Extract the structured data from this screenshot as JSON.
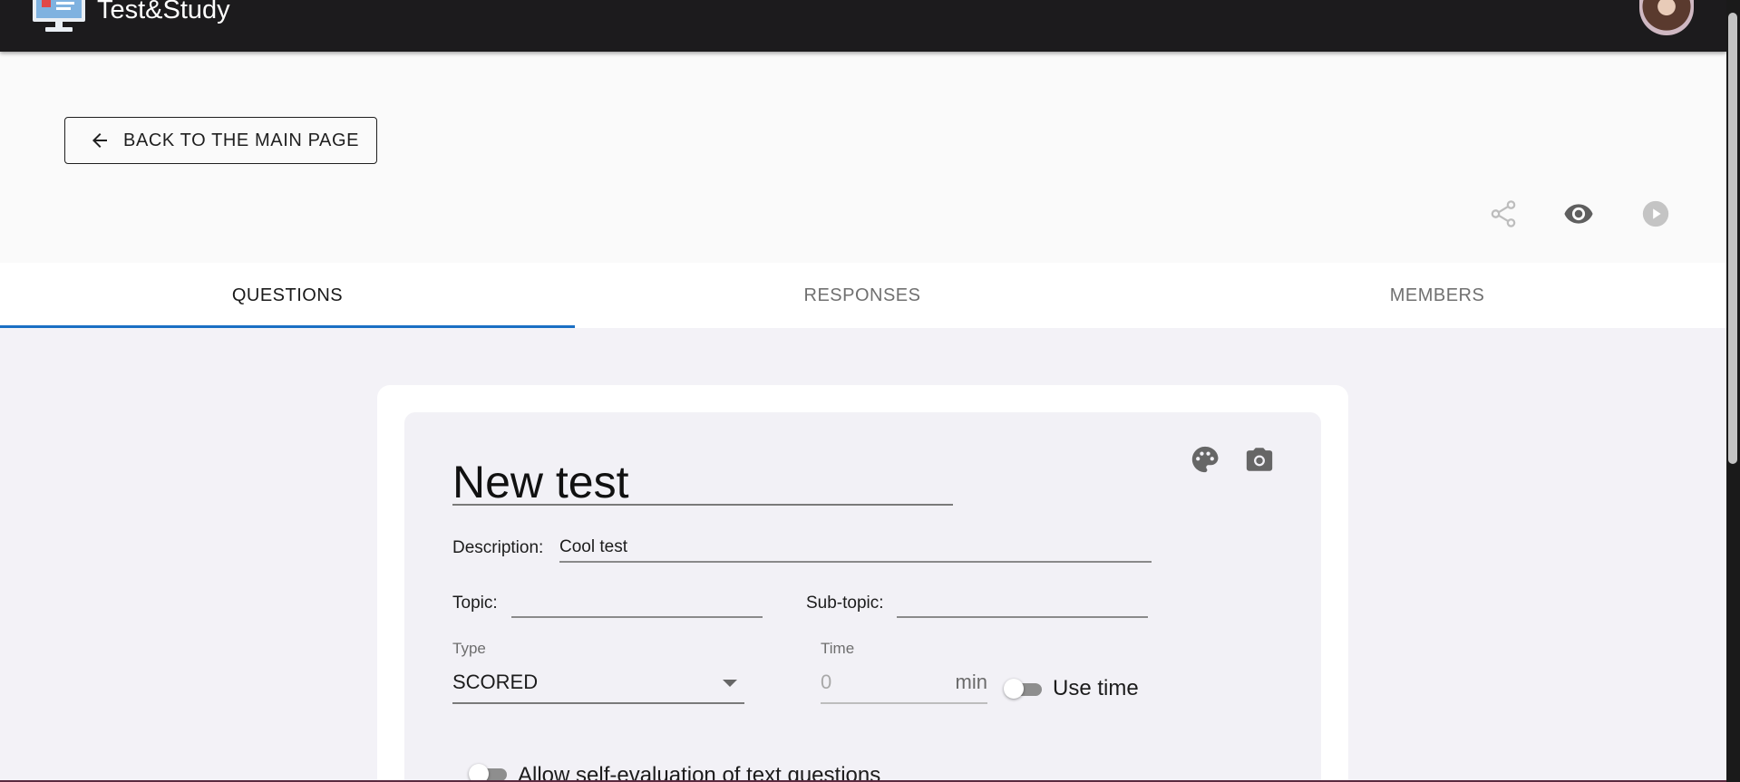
{
  "header": {
    "app_title": "Test&Study"
  },
  "top": {
    "back_label": "BACK TO THE MAIN PAGE",
    "actions": [
      "share-icon",
      "eye-icon",
      "play-circle-icon"
    ]
  },
  "tabs": [
    {
      "label": "QUESTIONS",
      "active": true
    },
    {
      "label": "RESPONSES",
      "active": false
    },
    {
      "label": "MEMBERS",
      "active": false
    }
  ],
  "form": {
    "title": "New test",
    "description_label": "Description:",
    "description_value": "Cool test",
    "topic_label": "Topic:",
    "topic_value": "",
    "subtopic_label": "Sub-topic:",
    "subtopic_value": "",
    "type_label": "Type",
    "type_value": "SCORED",
    "time_label": "Time",
    "time_value": "0",
    "time_unit": "min",
    "use_time_label": "Use time",
    "use_time_on": false,
    "self_eval_label": "Allow self-evaluation of text questions",
    "self_eval_on": false
  },
  "colors": {
    "accent": "#1a6fc4",
    "appbar": "#1c1b1d"
  }
}
